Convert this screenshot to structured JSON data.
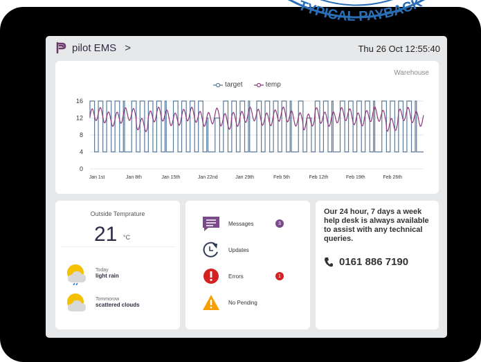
{
  "header": {
    "app_name": "pilot EMS",
    "chevron": ">",
    "datetime": "Thu 26 Oct 12:55:40"
  },
  "chart_card": {
    "location": "Warehouse"
  },
  "chart_data": {
    "type": "line",
    "x": [
      "Jan 1st",
      "Jan 8th",
      "Jan 15th",
      "Jan 22nd",
      "Jan 29th",
      "Feb 5th",
      "Feb 12th",
      "Feb 19th",
      "Feb 26th"
    ],
    "series": [
      {
        "name": "target",
        "color": "#5a7a9a",
        "pattern": "square wave alternating between 4 and 16"
      },
      {
        "name": "temp",
        "color": "#8a3a7a",
        "pattern": "oscillating roughly between 10 and 15"
      }
    ],
    "ylim": [
      0,
      16
    ],
    "yticks": [
      0,
      4,
      8,
      12,
      16
    ],
    "grid": true,
    "legend": "top-center"
  },
  "weather": {
    "title": "Outside Temprature",
    "value": "21",
    "unit": "°C",
    "today_label": "Today",
    "today_condition": "light rain",
    "tomorrow_label": "Tommorow",
    "tomorrow_condition": "scattered clouds"
  },
  "status": {
    "messages_label": "Messages",
    "messages_count": "3",
    "updates_label": "Updates",
    "errors_label": "Errors",
    "errors_count": "1",
    "pending_label": "No Pending",
    "colors": {
      "messages": "#7a4a8a",
      "errors": "#d22222",
      "warning": "#f5a000"
    }
  },
  "help": {
    "text": "Our 24 hour, 7 days a week help desk is always available to assist with any technical queries.",
    "phone": "0161 886 7190"
  },
  "stamp": {
    "text": "TYPICAL PAYBACK"
  }
}
